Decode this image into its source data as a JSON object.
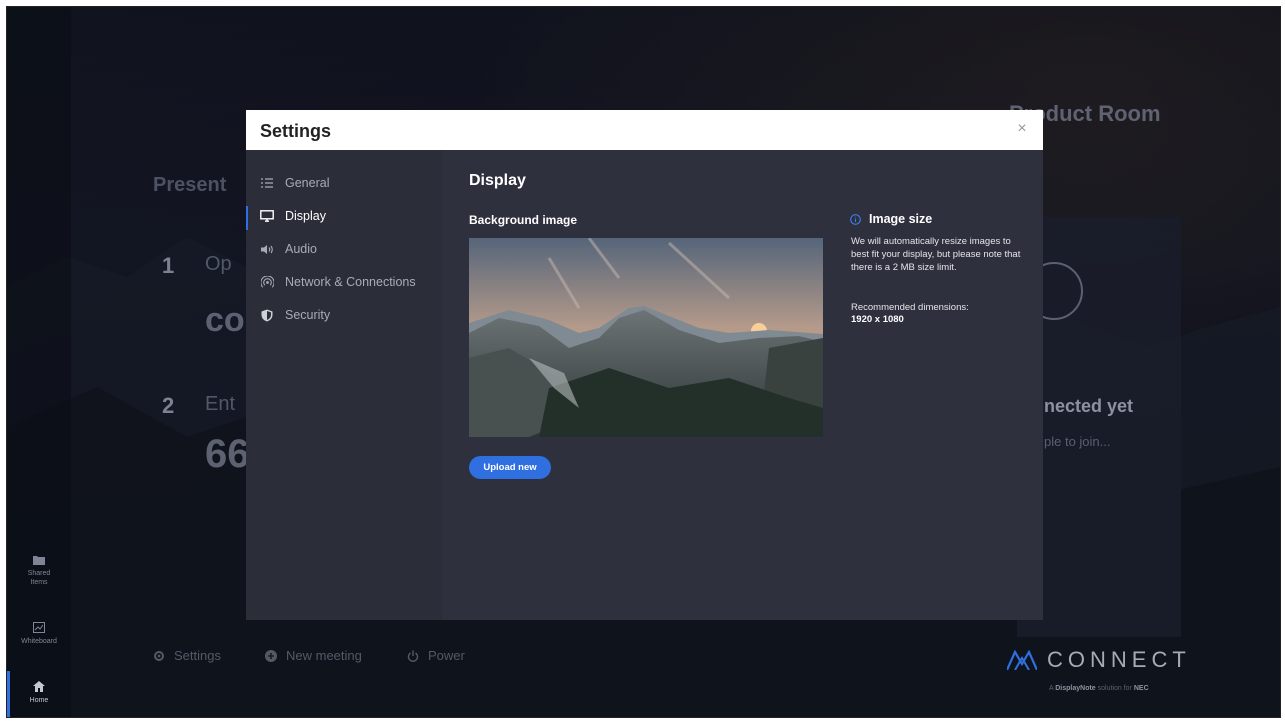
{
  "background": {
    "room_name": "Product Room",
    "present_heading": "Present",
    "step1_number": "1",
    "step1_text": "Op",
    "step1_code": "co",
    "step2_number": "2",
    "step2_text": "Ent",
    "step2_code": "66",
    "connected_status": "nected yet",
    "join_hint": "ple to join..."
  },
  "left_rail": {
    "items": [
      {
        "label": "Shared",
        "label2": "Items",
        "icon": "folder-icon"
      },
      {
        "label": "Whiteboard",
        "icon": "whiteboard-icon"
      },
      {
        "label": "Home",
        "icon": "home-icon",
        "active": true
      }
    ]
  },
  "bottom_bar": {
    "settings_label": "Settings",
    "new_meeting_label": "New meeting",
    "power_label": "Power"
  },
  "brand": {
    "name": "CONNECT",
    "sub_prefix": "A ",
    "sub_brand": "DisplayNote",
    "sub_mid": " solution for ",
    "sub_partner": "NEC"
  },
  "modal": {
    "title": "Settings",
    "close_symbol": "×",
    "nav": [
      {
        "label": "General",
        "icon": "list-icon"
      },
      {
        "label": "Display",
        "icon": "monitor-icon",
        "active": true
      },
      {
        "label": "Audio",
        "icon": "speaker-icon"
      },
      {
        "label": "Network & Connections",
        "icon": "wifi-icon"
      },
      {
        "label": "Security",
        "icon": "shield-icon"
      }
    ],
    "main": {
      "title": "Display",
      "background_image_label": "Background image",
      "upload_button": "Upload new",
      "info_title": "Image size",
      "info_text": "We will automatically resize images to best fit your display, but please note that there is a 2 MB size limit.",
      "recommended_label": "Recommended dimensions:",
      "recommended_value": "1920 x 1080"
    }
  },
  "colors": {
    "accent": "#2f6fe0",
    "modal_side": "#2b2d38",
    "modal_main": "#2f303d"
  }
}
